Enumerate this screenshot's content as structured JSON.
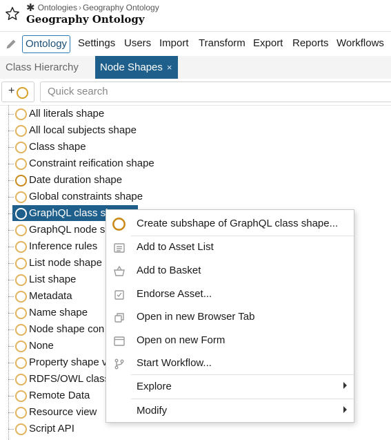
{
  "header": {
    "breadcrumb": [
      "Ontologies",
      "Geography Ontology"
    ],
    "title": "Geography Ontology"
  },
  "tabs": [
    {
      "label": "Ontology",
      "active": true
    },
    {
      "label": "Settings"
    },
    {
      "label": "Users"
    },
    {
      "label": "Import"
    },
    {
      "label": "Transform"
    },
    {
      "label": "Export"
    },
    {
      "label": "Reports"
    },
    {
      "label": "Workflows"
    }
  ],
  "subtabs": {
    "class_hierarchy": "Class Hierarchy",
    "node_shapes": "Node Shapes",
    "close_glyph": "×"
  },
  "toolbar": {
    "add_glyph": "+",
    "search_placeholder": "Quick search"
  },
  "tree": {
    "nodes": [
      "All literals shape",
      "All local subjects shape",
      "Class shape",
      "Constraint reification shape",
      "Date duration shape",
      "Global constraints shape",
      "GraphQL class shape",
      "GraphQL node sh",
      "Inference rules",
      "List node shape",
      "List shape",
      "Metadata",
      "Name shape",
      "Node shape con",
      "None",
      "Property shape v",
      "RDFS/OWL class",
      "Remote Data",
      "Resource view",
      "Script API"
    ],
    "selected": "GraphQL class sh"
  },
  "context_menu": {
    "items": [
      {
        "label": "Create subshape of GraphQL class shape...",
        "icon": "node-shape-icon"
      },
      {
        "label": "Add to Asset List",
        "icon": "list-icon"
      },
      {
        "label": "Add to Basket",
        "icon": "basket-icon"
      },
      {
        "label": "Endorse Asset...",
        "icon": "checkbox-icon"
      },
      {
        "label": "Open in new Browser Tab",
        "icon": "new-tab-icon"
      },
      {
        "label": "Open on new Form",
        "icon": "form-icon"
      },
      {
        "label": "Start Workflow...",
        "icon": "workflow-icon"
      },
      {
        "label": "Explore",
        "icon": "submenu-arrow-icon"
      },
      {
        "label": "Modify",
        "icon": "submenu-arrow-icon"
      }
    ]
  },
  "colors": {
    "accent": "#1f5f8b",
    "shape_icon": "#e2b35d",
    "selection": "#1f5f8b"
  }
}
